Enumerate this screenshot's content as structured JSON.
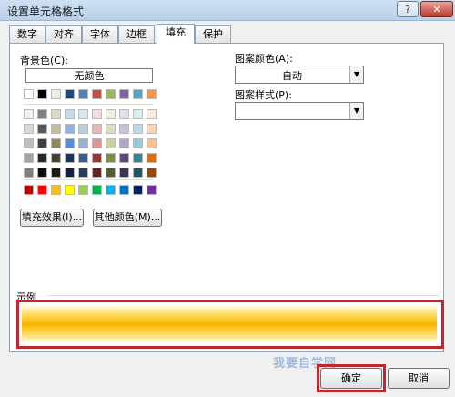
{
  "window": {
    "title": "设置单元格格式",
    "help_label": "?",
    "close_label": "✕"
  },
  "tabs": [
    {
      "label": "数字"
    },
    {
      "label": "对齐"
    },
    {
      "label": "字体"
    },
    {
      "label": "边框"
    },
    {
      "label": "填充",
      "active": true
    },
    {
      "label": "保护"
    }
  ],
  "fill": {
    "background_label": "背景色(C):",
    "no_color_label": "无颜色",
    "fill_effects_label": "填充效果(I)...",
    "more_colors_label": "其他颜色(M)...",
    "pattern_color_label": "图案颜色(A):",
    "pattern_color_value": "自动",
    "pattern_style_label": "图案样式(P):",
    "pattern_style_value": ""
  },
  "sample": {
    "label": "示例"
  },
  "footer": {
    "ok_label": "确定",
    "cancel_label": "取消"
  },
  "watermark": "我要自学网",
  "colors": {
    "accent_highlight": "#c0282d",
    "sample_gradient_center": "#f7b500"
  }
}
